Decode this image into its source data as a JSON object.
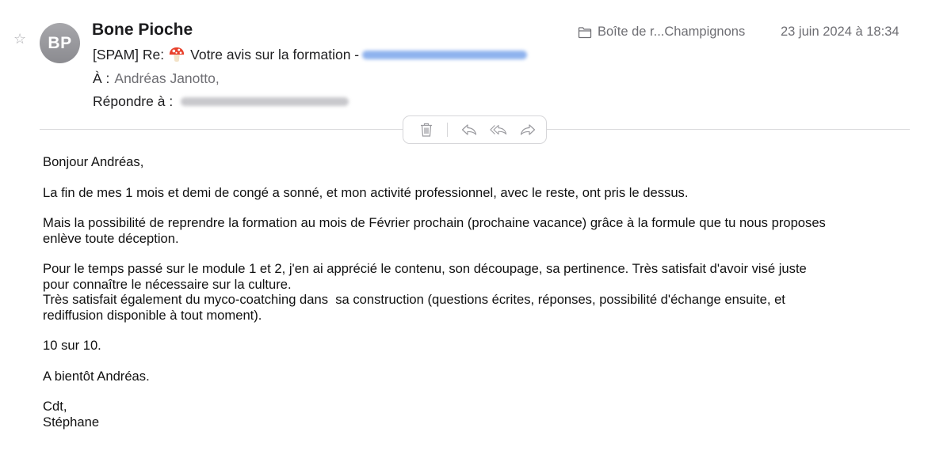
{
  "header": {
    "avatar_initials": "BP",
    "sender_name": "Bone Pioche",
    "subject_prefix": "[SPAM] Re:",
    "subject_text": "Votre avis sur la formation -",
    "to_label": "À :",
    "to_value": "Andréas Janotto,",
    "reply_to_label": "Répondre à :",
    "mailbox": "Boîte de r...Champignons",
    "date": "23 juin 2024 à 18:34",
    "icons": {
      "star": "star-icon",
      "mailbox": "folder-icon",
      "subject_emoji": "mushroom-icon"
    }
  },
  "toolbar": {
    "actions": [
      "trash-icon",
      "reply-icon",
      "reply-all-icon",
      "forward-icon"
    ]
  },
  "message": {
    "greeting": "Bonjour Andréas,",
    "p1": "La fin de mes 1 mois et demi de congé a sonné, et mon activité professionnel, avec le reste, ont pris le dessus.",
    "p2": "Mais la possibilité de reprendre la formation au mois de Février prochain (prochaine vacance) grâce à la formule que tu nous proposes\nenlève toute déception.",
    "p3": "Pour le temps passé sur le module 1 et 2, j'en ai apprécié le contenu, son découpage, sa pertinence. Très satisfait d'avoir visé juste\npour connaître le nécessaire sur la culture.\nTrès satisfait également du myco-coatching dans  sa construction (questions écrites, réponses, possibilité d'échange ensuite, et\nrediffusion disponible à tout moment).",
    "p4": "10 sur 10.",
    "p5": "A bientôt Andréas.",
    "signoff": "Cdt,\nStéphane"
  },
  "colors": {
    "avatar": "#9a9a9f",
    "secondary_text": "#6e6e73",
    "blurred_link": "#8fb3ee"
  }
}
